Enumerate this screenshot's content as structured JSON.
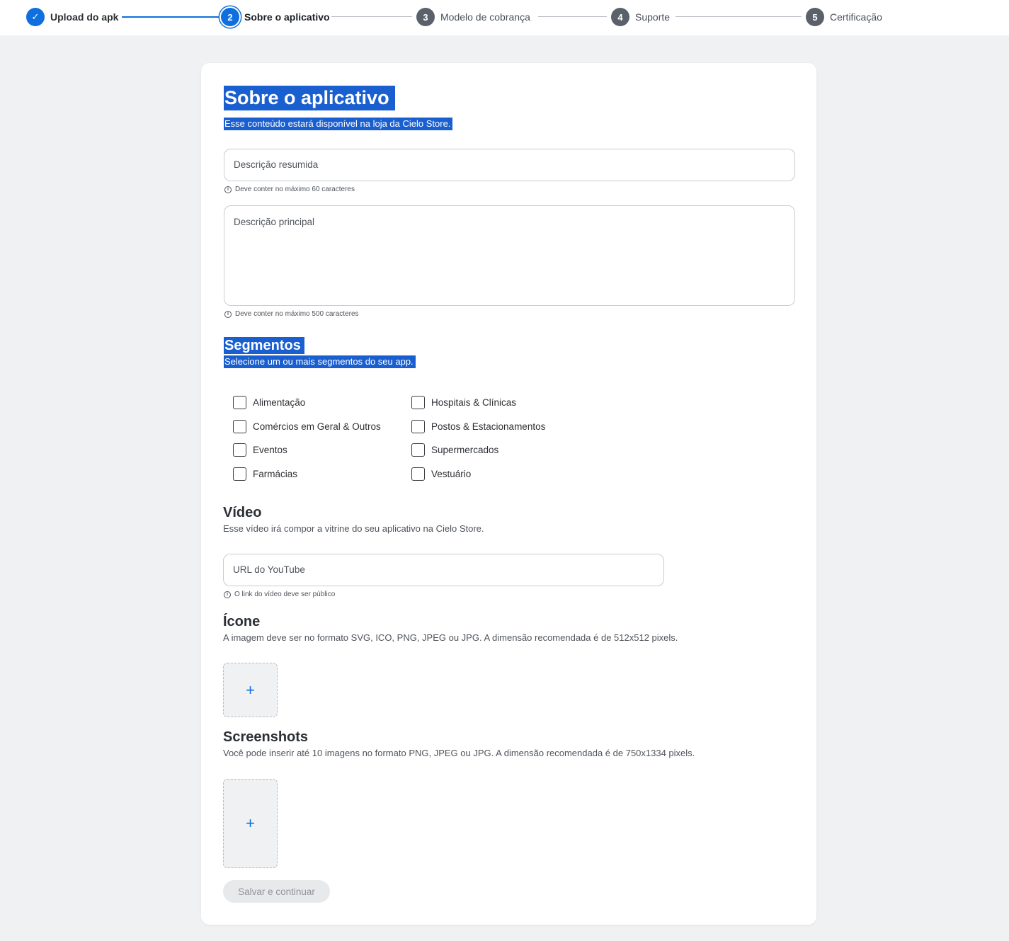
{
  "stepper": {
    "steps": [
      {
        "num": "✓",
        "label": "Upload do apk"
      },
      {
        "num": "2",
        "label": "Sobre o aplicativo"
      },
      {
        "num": "3",
        "label": "Modelo de cobrança"
      },
      {
        "num": "4",
        "label": "Suporte"
      },
      {
        "num": "5",
        "label": "Certificação"
      }
    ]
  },
  "about": {
    "title": "Sobre o aplicativo",
    "subtitle": "Esse conteúdo estará disponível na loja da Cielo Store.",
    "short_desc_placeholder": "Descrição resumida",
    "short_desc_hint": "Deve conter no máximo 60 caracteres",
    "main_desc_placeholder": "Descrição principal",
    "main_desc_hint": "Deve conter no máximo 500 caracteres"
  },
  "segments": {
    "title": "Segmentos",
    "subtitle": "Selecione um ou mais segmentos do seu app.",
    "col1": [
      "Alimentação",
      "Comércios em Geral & Outros",
      "Eventos",
      "Farmácias"
    ],
    "col2": [
      "Hospitais & Clínicas",
      "Postos & Estacionamentos",
      "Supermercados",
      "Vestuário"
    ]
  },
  "video": {
    "title": "Vídeo",
    "subtitle": "Esse vídeo irá compor a vitrine do seu aplicativo na Cielo Store.",
    "url_placeholder": "URL do YouTube",
    "hint": "O link do vídeo deve ser público"
  },
  "icon": {
    "title": "Ícone",
    "subtitle": "A imagem deve ser no formato SVG, ICO, PNG, JPEG ou JPG. A dimensão recomendada é de 512x512 pixels.",
    "add": "+"
  },
  "screenshots": {
    "title": "Screenshots",
    "subtitle": "Você pode inserir até 10 imagens no formato PNG, JPEG ou JPG. A dimensão recomendada é de 750x1334 pixels.",
    "add": "+"
  },
  "actions": {
    "save_continue": "Salvar e continuar"
  },
  "colors": {
    "accent": "#0f6fde",
    "selection": "#1a5fd0",
    "background": "#f0f1f3"
  }
}
